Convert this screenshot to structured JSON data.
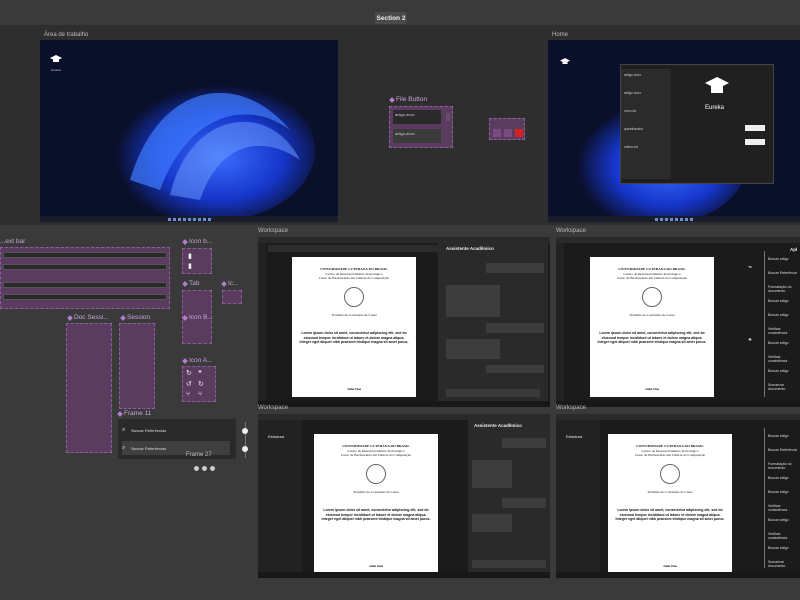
{
  "section2": {
    "label": "Section 2"
  },
  "frames": {
    "area_trabalho": "Área de trabalho",
    "home": "Home",
    "file_button": "File Button",
    "frame11": "Frame 11",
    "frame27": "Frame 27",
    "doc_session": "Doc Sessi...",
    "session": "Session",
    "icon_b1": "Icon b...",
    "icon_b2": "Icon B...",
    "icon_a": "Icon A...",
    "tab": "Tab",
    "ic": "Ic...",
    "toolbar": "...ext bar"
  },
  "workspace_label": "Workspace",
  "eureka": {
    "title": "Eureka",
    "desktop_icon_label": "Eureka"
  },
  "assistant": {
    "title": "Assistente Acadêmico"
  },
  "document": {
    "univ": "UNIVERSIDADE LUTERANA DO BRASIL",
    "center": "Centro de Desenvolvimento Tecnológico",
    "course": "Curso de Bacharelado em Ciência da Computação",
    "work": "Trabalho de Conclusão de Curso",
    "lorem": "Lorem ipsum dolor sit amet, consectetur adipiscing elit, sed do eiusmod tempor incididunt ut labore et dolore magna aliqua. Integer eget aliquet nibh praesent tristique magna sit amet purus.",
    "author": "John Doe"
  },
  "structure": {
    "title": "Estrutura"
  },
  "right_panel_title": "Apl",
  "actions": [
    "Buscar artigo",
    "Buscar Referência",
    "Formatação do documento",
    "Buscar artigo",
    "Buscar artigo",
    "Verificar consistência",
    "Buscar artigo",
    "Verificar consistência",
    "Buscar artigo",
    "Sumarizar documento"
  ],
  "frame11": {
    "items": [
      "Buscar Referências",
      "Buscar Referências"
    ]
  },
  "file_button_items": [
    "artigo.docx",
    "artigo.docx"
  ],
  "home_list": [
    "artigo.docx",
    "artigo.docx",
    "novo.txt",
    "questionário",
    "ultimo.txt"
  ]
}
